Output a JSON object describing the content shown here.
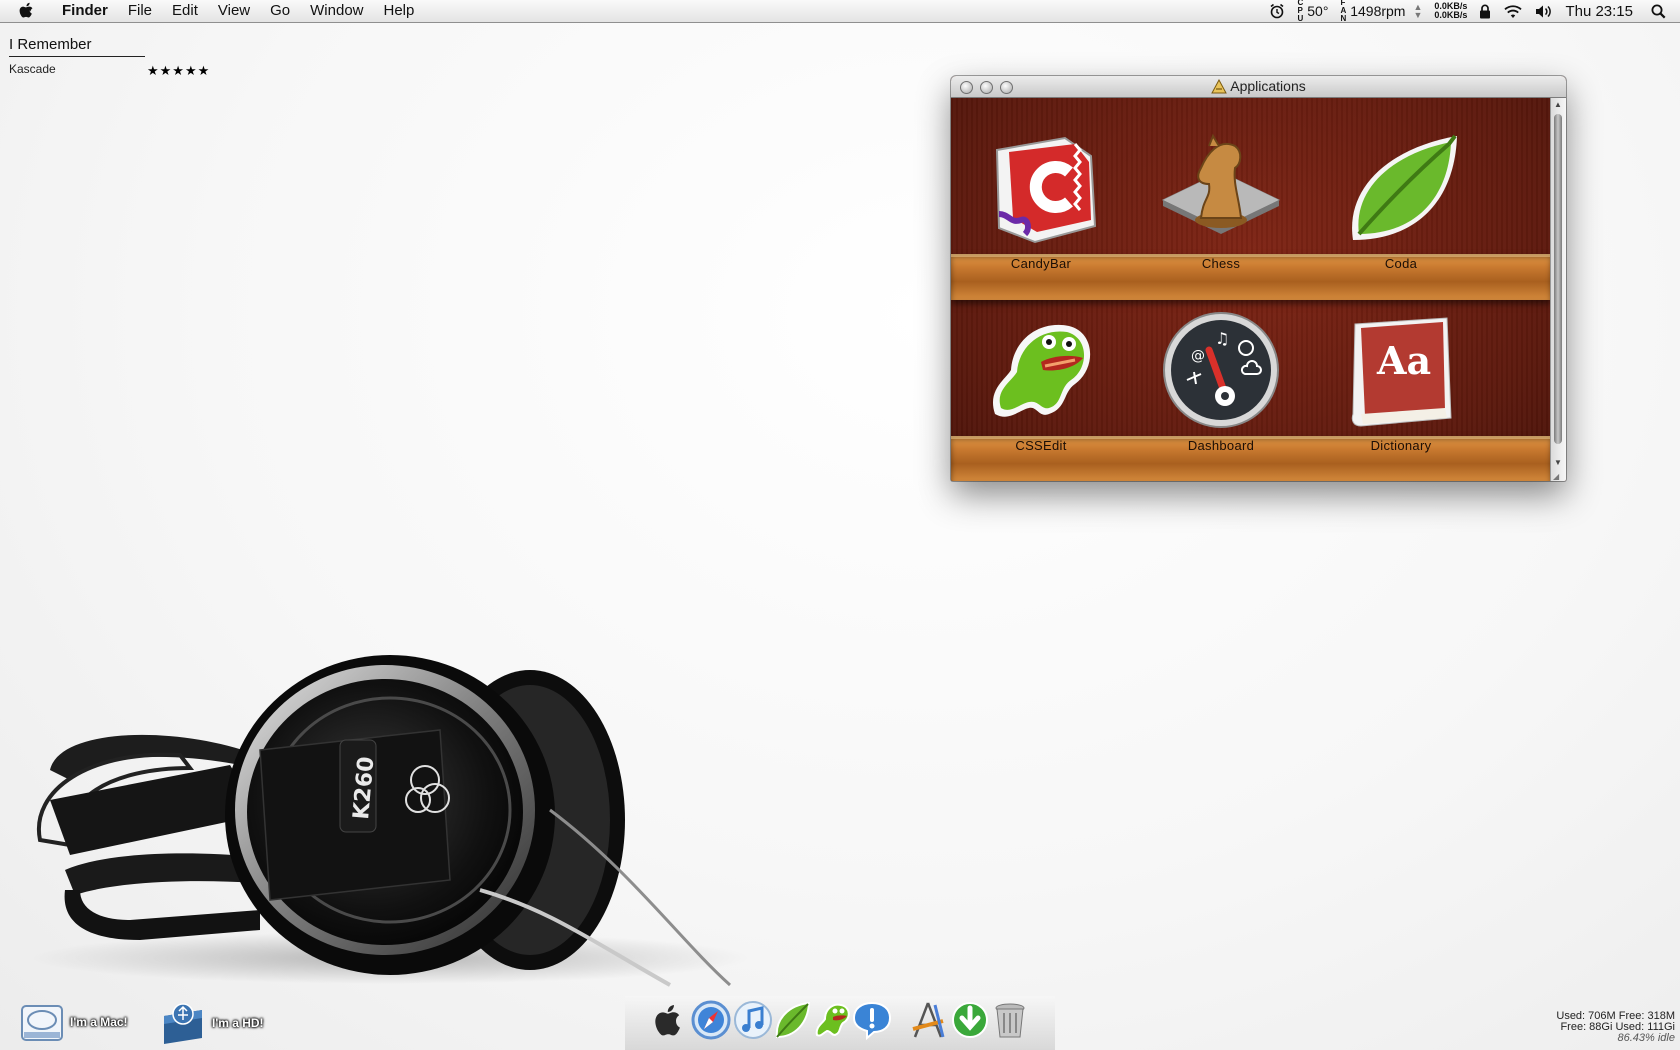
{
  "menubar": {
    "app_name": "Finder",
    "menus": [
      "File",
      "Edit",
      "View",
      "Go",
      "Window",
      "Help"
    ],
    "temp_tiny": [
      "C",
      "P",
      "U"
    ],
    "temp": "50°",
    "fan_tiny": [
      "F",
      "A",
      "N"
    ],
    "fan": "1498rpm",
    "net_up": "0.0KB/s",
    "net_down": "0.0KB/s",
    "clock": "Thu 23:15"
  },
  "nowplaying": {
    "title": "I Remember",
    "artist": "Kascade",
    "stars": "★★★★★"
  },
  "window": {
    "title": "Applications",
    "apps": [
      {
        "label": "CandyBar",
        "icon": "candybar-icon"
      },
      {
        "label": "Chess",
        "icon": "chess-icon"
      },
      {
        "label": "Coda",
        "icon": "coda-leaf-icon"
      },
      {
        "label": "CSSEdit",
        "icon": "cssedit-icon"
      },
      {
        "label": "Dashboard",
        "icon": "dashboard-icon"
      },
      {
        "label": "Dictionary",
        "icon": "dictionary-icon"
      }
    ]
  },
  "desktop": {
    "drives": [
      {
        "label": "I'm a Mac!",
        "icon": "mac-drive-icon"
      },
      {
        "label": "I'm a HD!",
        "icon": "usb-drive-icon"
      }
    ]
  },
  "dock": {
    "items": [
      "finder-icon",
      "safari-icon",
      "itunes-icon",
      "coda-icon",
      "cssedit-icon",
      "growl-icon",
      "xcode-icon",
      "downloads-icon",
      "trash-icon"
    ]
  },
  "stats": {
    "memory": "Used: 706M Free: 318M",
    "disk": "Free: 88Gi Used: 111Gi",
    "cpu": "86.43% idle"
  }
}
